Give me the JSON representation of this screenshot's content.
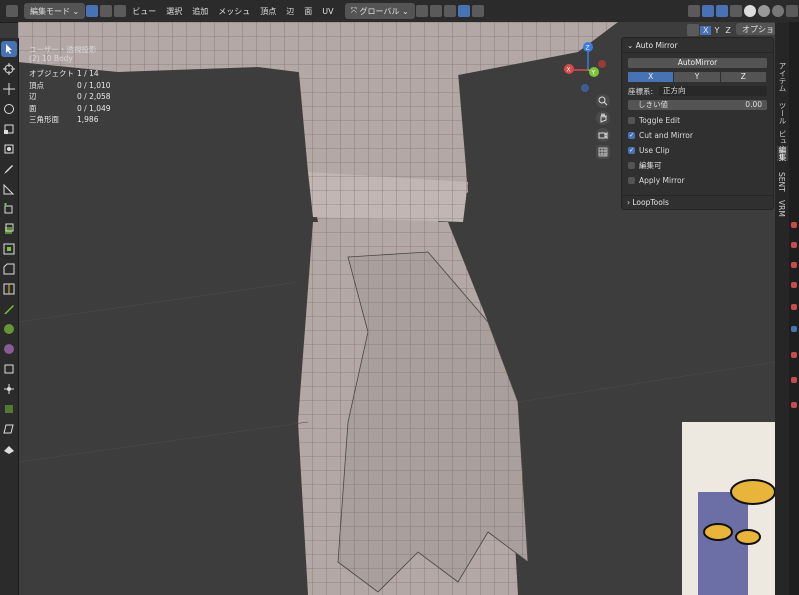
{
  "header": {
    "mode": "編集モード",
    "menus": [
      "ビュー",
      "選択",
      "追加",
      "メッシュ",
      "頂点",
      "辺",
      "面",
      "UV"
    ],
    "transform_orientation": "グローバル",
    "axes": [
      "X",
      "Y",
      "Z"
    ],
    "options": "オプション"
  },
  "viewport": {
    "mode_label": "ユーザー・透視投影",
    "object_label": "(2) 10 Body",
    "stats": [
      {
        "label": "オブジェクト",
        "value": "1 / 14"
      },
      {
        "label": "頂点",
        "value": "0 / 1,010"
      },
      {
        "label": "辺",
        "value": "0 / 2,058"
      },
      {
        "label": "面",
        "value": "0 / 1,049"
      },
      {
        "label": "三角形面",
        "value": "1,986"
      }
    ],
    "gizmo": {
      "x": "X",
      "y": "Y",
      "z": "Z"
    }
  },
  "npanel": {
    "title": "Auto Mirror",
    "button": "AutoMirror",
    "axes": [
      "X",
      "Y",
      "Z"
    ],
    "active_axis": "X",
    "orientation_label": "座標系:",
    "orientation_value": "正方向",
    "threshold_label": "しきい値",
    "threshold_value": "0.00",
    "toggles": [
      {
        "label": "Toggle Edit",
        "checked": false
      },
      {
        "label": "Cut and Mirror",
        "checked": true
      },
      {
        "label": "Use Clip",
        "checked": true
      },
      {
        "label": "編集可",
        "checked": false
      },
      {
        "label": "Apply Mirror",
        "checked": false
      }
    ],
    "loop_tools": "LoopTools"
  },
  "tabs": [
    "アイテム",
    "ツール",
    "ビュー",
    "編集",
    "SENT",
    "VRM"
  ],
  "colors": {
    "accent": "#4772b3",
    "mesh": "#b3a8a6",
    "bg": "#3d3d3d"
  }
}
